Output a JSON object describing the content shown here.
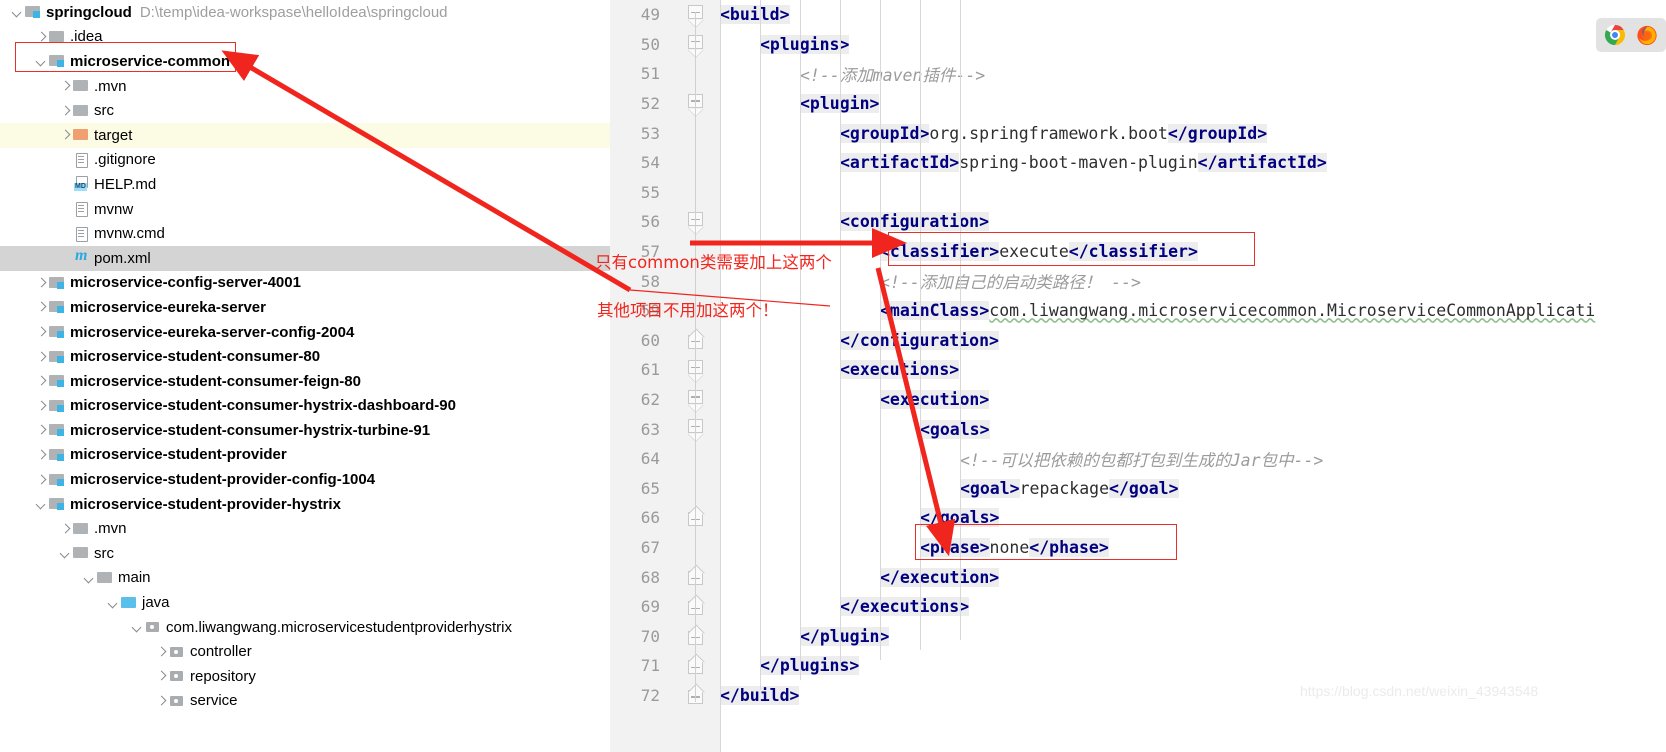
{
  "project_tree": {
    "root": {
      "label": "springcloud",
      "path": "D:\\temp\\idea-workspase\\helloIdea\\springcloud",
      "icon": "module-folder-icon",
      "expanded": true
    },
    "items": [
      {
        "label": ".idea",
        "indent": 1,
        "icon": "folder-icon",
        "arrow": "right",
        "bold": false,
        "state": "normal"
      },
      {
        "label": "microservice-common",
        "indent": 1,
        "icon": "module-folder-icon",
        "arrow": "down",
        "bold": true,
        "state": "boxed"
      },
      {
        "label": ".mvn",
        "indent": 2,
        "icon": "folder-icon",
        "arrow": "right",
        "bold": false,
        "state": "normal"
      },
      {
        "label": "src",
        "indent": 2,
        "icon": "folder-icon",
        "arrow": "right",
        "bold": false,
        "state": "normal"
      },
      {
        "label": "target",
        "indent": 2,
        "icon": "folder-orange-icon",
        "arrow": "right",
        "bold": false,
        "state": "highlight"
      },
      {
        "label": ".gitignore",
        "indent": 2,
        "icon": "file-icon",
        "arrow": "none",
        "bold": false,
        "state": "normal"
      },
      {
        "label": "HELP.md",
        "indent": 2,
        "icon": "md-file-icon",
        "arrow": "none",
        "bold": false,
        "state": "normal"
      },
      {
        "label": "mvnw",
        "indent": 2,
        "icon": "file-icon",
        "arrow": "none",
        "bold": false,
        "state": "normal"
      },
      {
        "label": "mvnw.cmd",
        "indent": 2,
        "icon": "file-icon",
        "arrow": "none",
        "bold": false,
        "state": "normal"
      },
      {
        "label": "pom.xml",
        "indent": 2,
        "icon": "maven-icon",
        "arrow": "none",
        "bold": false,
        "state": "selected"
      },
      {
        "label": "microservice-config-server-4001",
        "indent": 1,
        "icon": "module-folder-icon",
        "arrow": "right",
        "bold": true,
        "state": "normal"
      },
      {
        "label": "microservice-eureka-server",
        "indent": 1,
        "icon": "module-folder-icon",
        "arrow": "right",
        "bold": true,
        "state": "normal"
      },
      {
        "label": "microservice-eureka-server-config-2004",
        "indent": 1,
        "icon": "module-folder-icon",
        "arrow": "right",
        "bold": true,
        "state": "normal"
      },
      {
        "label": "microservice-student-consumer-80",
        "indent": 1,
        "icon": "module-folder-icon",
        "arrow": "right",
        "bold": true,
        "state": "normal"
      },
      {
        "label": "microservice-student-consumer-feign-80",
        "indent": 1,
        "icon": "module-folder-icon",
        "arrow": "right",
        "bold": true,
        "state": "normal"
      },
      {
        "label": "microservice-student-consumer-hystrix-dashboard-90",
        "indent": 1,
        "icon": "module-folder-icon",
        "arrow": "right",
        "bold": true,
        "state": "normal"
      },
      {
        "label": "microservice-student-consumer-hystrix-turbine-91",
        "indent": 1,
        "icon": "module-folder-icon",
        "arrow": "right",
        "bold": true,
        "state": "normal"
      },
      {
        "label": "microservice-student-provider",
        "indent": 1,
        "icon": "module-folder-icon",
        "arrow": "right",
        "bold": true,
        "state": "normal"
      },
      {
        "label": "microservice-student-provider-config-1004",
        "indent": 1,
        "icon": "module-folder-icon",
        "arrow": "right",
        "bold": true,
        "state": "normal"
      },
      {
        "label": "microservice-student-provider-hystrix",
        "indent": 1,
        "icon": "module-folder-icon",
        "arrow": "down",
        "bold": true,
        "state": "normal"
      },
      {
        "label": ".mvn",
        "indent": 2,
        "icon": "folder-icon",
        "arrow": "right",
        "bold": false,
        "state": "normal"
      },
      {
        "label": "src",
        "indent": 2,
        "icon": "folder-icon",
        "arrow": "down",
        "bold": false,
        "state": "normal"
      },
      {
        "label": "main",
        "indent": 3,
        "icon": "folder-icon",
        "arrow": "down",
        "bold": false,
        "state": "normal"
      },
      {
        "label": "java",
        "indent": 4,
        "icon": "folder-blue-icon",
        "arrow": "down",
        "bold": false,
        "state": "normal"
      },
      {
        "label": "com.liwangwang.microservicestudentproviderhystrix",
        "indent": 5,
        "icon": "package-icon",
        "arrow": "down",
        "bold": false,
        "state": "normal"
      },
      {
        "label": "controller",
        "indent": 6,
        "icon": "package-icon",
        "arrow": "right",
        "bold": false,
        "state": "normal"
      },
      {
        "label": "repository",
        "indent": 6,
        "icon": "package-icon",
        "arrow": "right",
        "bold": false,
        "state": "normal"
      },
      {
        "label": "service",
        "indent": 6,
        "icon": "package-icon",
        "arrow": "right",
        "bold": false,
        "state": "normal"
      }
    ]
  },
  "editor": {
    "first_line_number": 49,
    "lines": [
      {
        "num": 49,
        "indent": 0,
        "fold": "start",
        "segments": [
          {
            "t": "<build>",
            "c": "tag",
            "hl": true
          }
        ]
      },
      {
        "num": 50,
        "indent": 1,
        "fold": "start",
        "segments": [
          {
            "t": "<plugins>",
            "c": "tag",
            "hl": true
          }
        ]
      },
      {
        "num": 51,
        "indent": 2,
        "fold": "none",
        "segments": [
          {
            "t": "<!--添加maven插件-->",
            "c": "cmt",
            "hl": false
          }
        ]
      },
      {
        "num": 52,
        "indent": 2,
        "fold": "start",
        "segments": [
          {
            "t": "<plugin>",
            "c": "tag",
            "hl": true
          }
        ]
      },
      {
        "num": 53,
        "indent": 3,
        "fold": "none",
        "segments": [
          {
            "t": "<groupId>",
            "c": "tag",
            "hl": true
          },
          {
            "t": "org.springframework.boot",
            "c": "val",
            "hl": false
          },
          {
            "t": "</groupId>",
            "c": "tag",
            "hl": true
          }
        ]
      },
      {
        "num": 54,
        "indent": 3,
        "fold": "none",
        "segments": [
          {
            "t": "<artifactId>",
            "c": "tag",
            "hl": true
          },
          {
            "t": "spring-boot-maven-plugin",
            "c": "val",
            "hl": false
          },
          {
            "t": "</artifactId>",
            "c": "tag",
            "hl": true
          }
        ]
      },
      {
        "num": 55,
        "indent": 3,
        "fold": "none",
        "segments": []
      },
      {
        "num": 56,
        "indent": 3,
        "fold": "start",
        "segments": [
          {
            "t": "<configuration>",
            "c": "tag",
            "hl": true
          }
        ]
      },
      {
        "num": 57,
        "indent": 4,
        "fold": "none",
        "segments": [
          {
            "t": "<classifier>",
            "c": "tag",
            "hl": true
          },
          {
            "t": "execute",
            "c": "val",
            "hl": false
          },
          {
            "t": "</classifier>",
            "c": "tag",
            "hl": true
          }
        ]
      },
      {
        "num": 58,
        "indent": 4,
        "fold": "none",
        "segments": [
          {
            "t": "<!--添加自己的启动类路径！ -->",
            "c": "cmt",
            "hl": false
          }
        ]
      },
      {
        "num": 59,
        "indent": 4,
        "fold": "none",
        "segments": [
          {
            "t": "<mainClass>",
            "c": "tag",
            "hl": true
          },
          {
            "t": "com.liwangwang.microservicecommon.MicroserviceCommonApplicati",
            "c": "val squiggle",
            "hl": false
          }
        ]
      },
      {
        "num": 60,
        "indent": 3,
        "fold": "end",
        "segments": [
          {
            "t": "</configuration>",
            "c": "tag",
            "hl": true
          }
        ]
      },
      {
        "num": 61,
        "indent": 3,
        "fold": "start",
        "segments": [
          {
            "t": "<executions>",
            "c": "tag",
            "hl": true
          }
        ]
      },
      {
        "num": 62,
        "indent": 4,
        "fold": "start",
        "segments": [
          {
            "t": "<execution>",
            "c": "tag",
            "hl": true
          }
        ]
      },
      {
        "num": 63,
        "indent": 5,
        "fold": "start",
        "segments": [
          {
            "t": "<goals>",
            "c": "tag",
            "hl": true
          }
        ]
      },
      {
        "num": 64,
        "indent": 6,
        "fold": "none",
        "segments": [
          {
            "t": "<!--可以把依赖的包都打包到生成的Jar包中-->",
            "c": "cmt",
            "hl": false
          }
        ]
      },
      {
        "num": 65,
        "indent": 6,
        "fold": "none",
        "segments": [
          {
            "t": "<goal>",
            "c": "tag",
            "hl": true
          },
          {
            "t": "repackage",
            "c": "val",
            "hl": false
          },
          {
            "t": "</goal>",
            "c": "tag",
            "hl": true
          }
        ]
      },
      {
        "num": 66,
        "indent": 5,
        "fold": "end",
        "segments": [
          {
            "t": "</goals>",
            "c": "tag",
            "hl": true
          }
        ]
      },
      {
        "num": 67,
        "indent": 5,
        "fold": "none",
        "segments": [
          {
            "t": "<phase>",
            "c": "tag",
            "hl": true
          },
          {
            "t": "none",
            "c": "val",
            "hl": false
          },
          {
            "t": "</phase>",
            "c": "tag",
            "hl": true
          }
        ]
      },
      {
        "num": 68,
        "indent": 4,
        "fold": "end",
        "segments": [
          {
            "t": "</execution>",
            "c": "tag",
            "hl": true
          }
        ]
      },
      {
        "num": 69,
        "indent": 3,
        "fold": "end",
        "segments": [
          {
            "t": "</executions>",
            "c": "tag",
            "hl": true
          }
        ]
      },
      {
        "num": 70,
        "indent": 2,
        "fold": "end",
        "segments": [
          {
            "t": "</plugin>",
            "c": "tag",
            "hl": true
          }
        ]
      },
      {
        "num": 71,
        "indent": 1,
        "fold": "end",
        "segments": [
          {
            "t": "</plugins>",
            "c": "tag",
            "hl": true
          }
        ]
      },
      {
        "num": 72,
        "indent": 0,
        "fold": "end",
        "segments": [
          {
            "t": "</build>",
            "c": "tag",
            "hl": true
          }
        ]
      }
    ]
  },
  "annotations": {
    "note_1": "只有common类需要加上这两个",
    "note_2": "其他项目不用加这两个！",
    "color": "#f0261e"
  },
  "browser_tray": {
    "chrome_label": "chrome-icon",
    "firefox_label": "firefox-icon"
  },
  "watermark": {
    "text": "https://blog.csdn.net/weixin_43943548"
  }
}
